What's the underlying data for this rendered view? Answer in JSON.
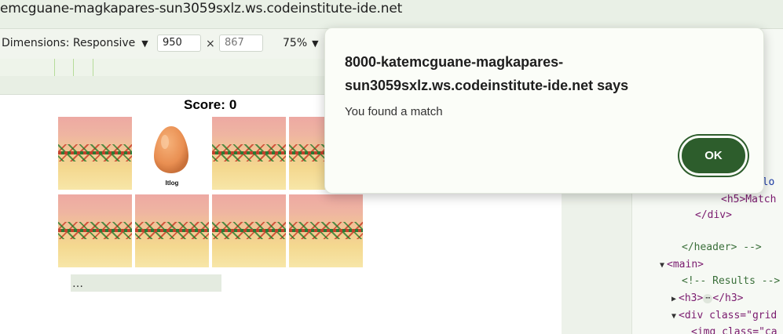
{
  "browser": {
    "url_text": "emcguane-magkapares-sun3059sxlz.ws.codeinstitute-ide.net"
  },
  "device_toolbar": {
    "dimensions_label": "Dimensions: Responsive",
    "width_value": "950",
    "height_placeholder": "867",
    "times_symbol": "×",
    "zoom_label": "75%",
    "caret": "▼"
  },
  "game": {
    "score_label": "Score:",
    "score_value": "0",
    "revealed_card_label": "Itlog"
  },
  "devtools": {
    "lines": [
      {
        "text": "=\"lo"
      },
      {
        "text": "<h5>Match"
      },
      {
        "text": "</div>"
      },
      {
        "text": "</header> -->"
      },
      {
        "text": "<main>"
      },
      {
        "text": "<!-- Results -->"
      },
      {
        "text": "<h3>"
      },
      {
        "text": "</h3>"
      },
      {
        "text": "<div class=\"grid"
      },
      {
        "text": "<img class=\"ca"
      }
    ],
    "ellipsis": "…",
    "inline_dots": "⋯"
  },
  "dialog": {
    "origin": "8000-katemcguane-magkapares-sun3059sxlz.ws.codeinstitute-ide.net says",
    "message": "You found a match",
    "ok_label": "OK"
  }
}
